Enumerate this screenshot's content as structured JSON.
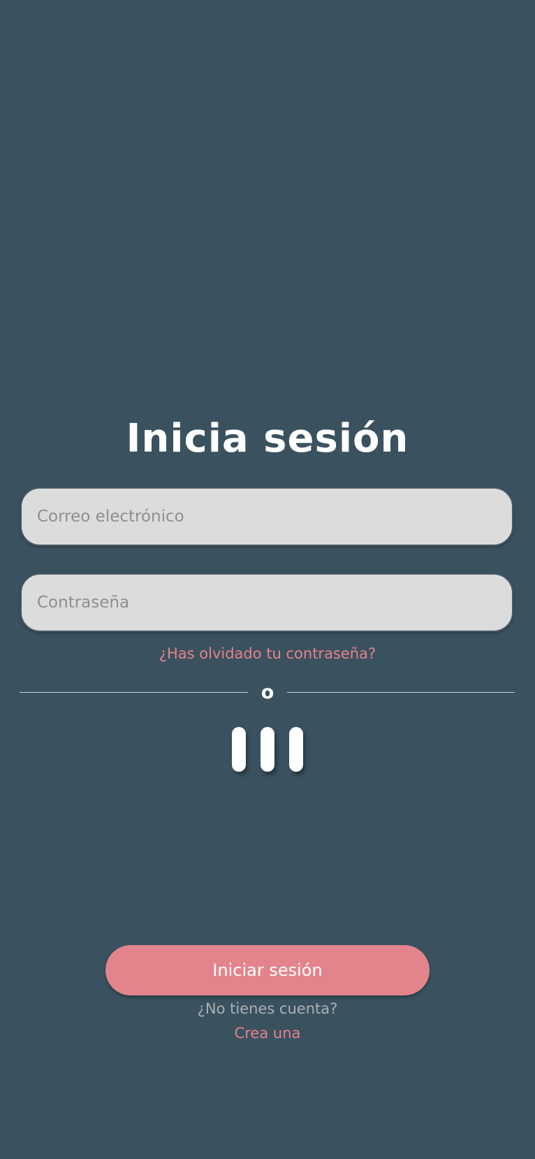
{
  "login": {
    "title": "Inicia sesión",
    "email_placeholder": "Correo electrónico",
    "password_placeholder": "Contraseña",
    "forgot_password": "¿Has olvidado tu contraseña?",
    "divider_label": "o",
    "submit_label": "Iniciar sesión",
    "no_account": "¿No tienes cuenta?",
    "create_account": "Crea una"
  },
  "colors": {
    "background": "#3a5260",
    "input_background": "#dcdcdc",
    "accent": "#e3848c",
    "link": "#e8808a",
    "muted_text": "#a9b0b4"
  },
  "icons": {
    "loader": "loading-bars-icon"
  }
}
